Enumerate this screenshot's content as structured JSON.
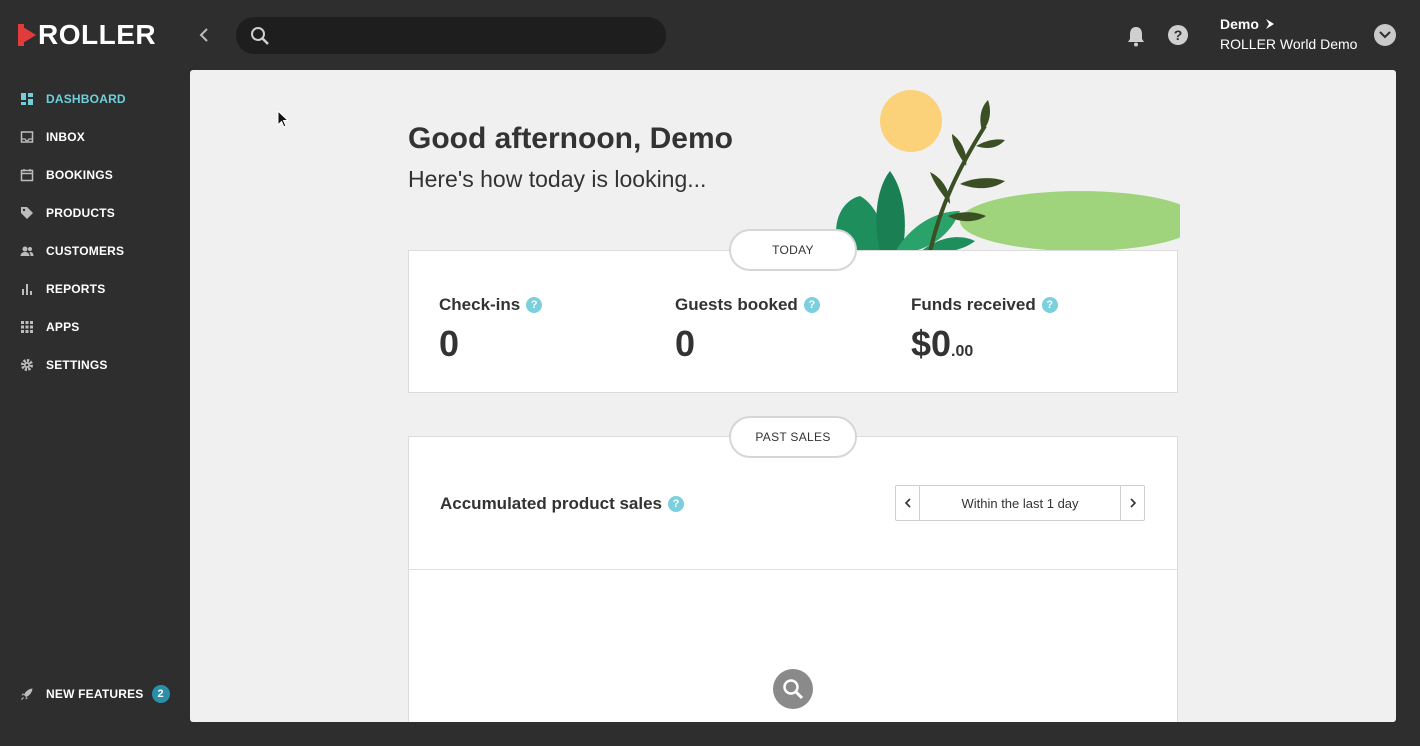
{
  "app": {
    "logo_text": "ROLLER"
  },
  "search": {
    "placeholder": "",
    "value": ""
  },
  "account": {
    "name": "Demo",
    "venue": "ROLLER World Demo"
  },
  "sidebar": {
    "items": [
      {
        "label": "DASHBOARD",
        "icon": "dashboard-icon",
        "active": true
      },
      {
        "label": "INBOX",
        "icon": "inbox-icon"
      },
      {
        "label": "BOOKINGS",
        "icon": "calendar-icon"
      },
      {
        "label": "PRODUCTS",
        "icon": "tag-icon"
      },
      {
        "label": "CUSTOMERS",
        "icon": "people-icon"
      },
      {
        "label": "REPORTS",
        "icon": "bar-chart-icon"
      },
      {
        "label": "APPS",
        "icon": "apps-grid-icon"
      },
      {
        "label": "SETTINGS",
        "icon": "gear-icon"
      }
    ],
    "new_features": {
      "label": "NEW FEATURES",
      "count": "2",
      "icon": "rocket-icon"
    }
  },
  "main": {
    "greeting": "Good afternoon, Demo",
    "subgreeting": "Here's how today is looking...",
    "today": {
      "pill": "TODAY",
      "stats": [
        {
          "label": "Check-ins",
          "value": "0"
        },
        {
          "label": "Guests booked",
          "value": "0"
        },
        {
          "label": "Funds received",
          "value": "$0",
          "cents": ".00"
        }
      ]
    },
    "past_sales": {
      "pill": "PAST SALES",
      "title": "Accumulated product sales",
      "range": "Within the last 1 day"
    }
  },
  "colors": {
    "accent": "#6fd0da",
    "brand_red": "#e23b3b",
    "badge": "#2a8fa8"
  }
}
